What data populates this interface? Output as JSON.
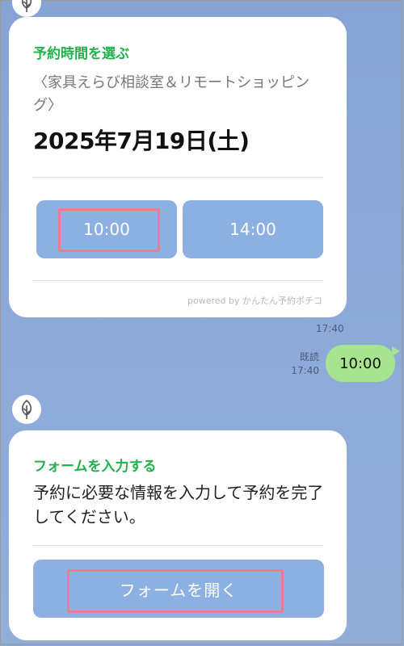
{
  "message1": {
    "title": "予約時間を選ぶ",
    "subtitle": "〈家具えらび相談室＆リモートショッピング〉",
    "date": "2025年7月19日(土)",
    "times": [
      "10:00",
      "14:00"
    ],
    "powered_by": "powered by かんたん予約ポチコ",
    "timestamp": "17:40"
  },
  "reply": {
    "read_label": "既読",
    "timestamp": "17:40",
    "text": "10:00"
  },
  "message2": {
    "title": "フォームを入力する",
    "body": "予約に必要な情報を入力して予約を完了してください。",
    "button": "フォームを開く"
  },
  "colors": {
    "accent_green": "#23b14d",
    "button_blue": "#8db0e3",
    "highlight": "#ef7c8e",
    "bubble_green": "#a7e48f",
    "background": "#8aa6d7"
  },
  "icons": {
    "avatar": "tree-leaf-icon"
  }
}
